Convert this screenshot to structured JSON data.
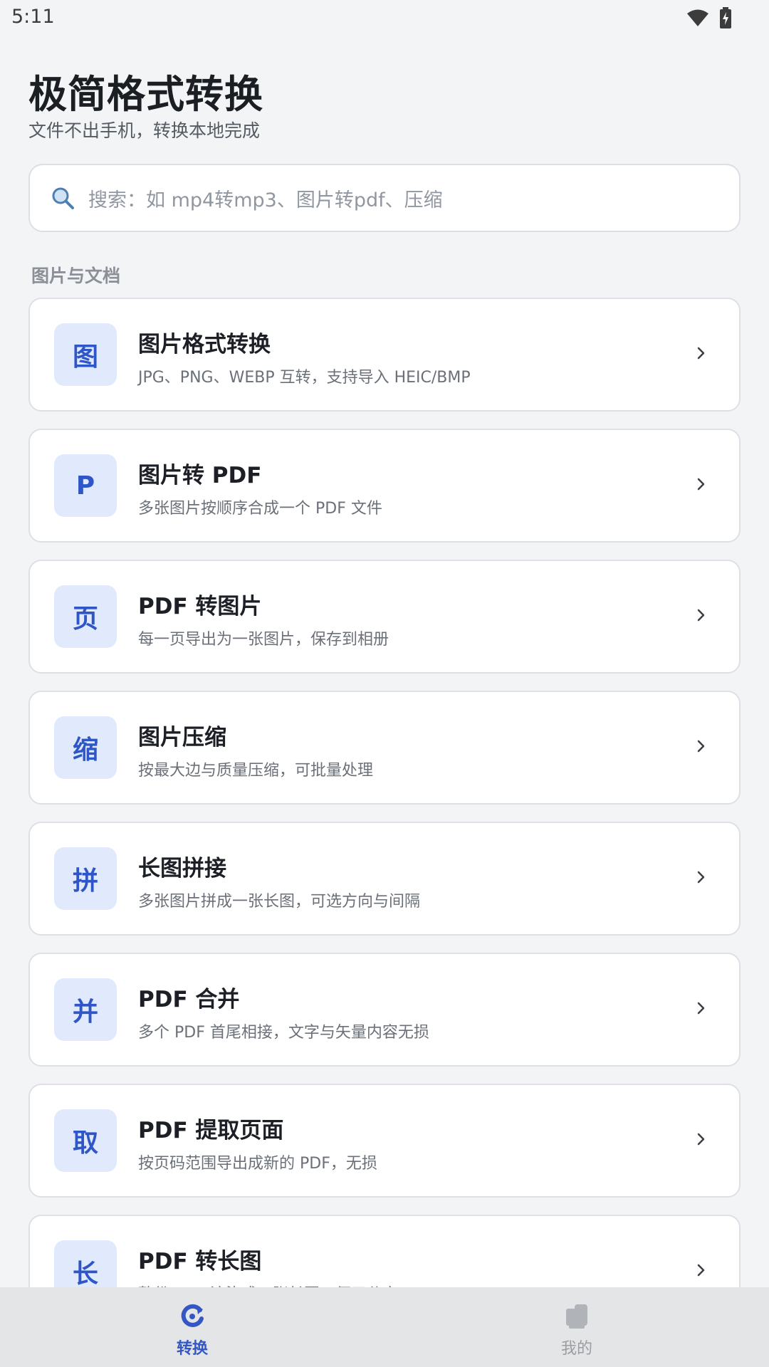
{
  "status_bar": {
    "time": "5:11"
  },
  "header": {
    "title": "极简格式转换",
    "subtitle": "文件不出手机，转换本地完成"
  },
  "search": {
    "placeholder": "搜索：如 mp4转mp3、图片转pdf、压缩"
  },
  "section": {
    "label": "图片与文档"
  },
  "tools": [
    {
      "icon_char": "图",
      "title": "图片格式转换",
      "desc": "JPG、PNG、WEBP 互转，支持导入 HEIC/BMP"
    },
    {
      "icon_char": "P",
      "title": "图片转 PDF",
      "desc": "多张图片按顺序合成一个 PDF 文件"
    },
    {
      "icon_char": "页",
      "title": "PDF 转图片",
      "desc": "每一页导出为一张图片，保存到相册"
    },
    {
      "icon_char": "缩",
      "title": "图片压缩",
      "desc": "按最大边与质量压缩，可批量处理"
    },
    {
      "icon_char": "拼",
      "title": "长图拼接",
      "desc": "多张图片拼成一张长图，可选方向与间隔"
    },
    {
      "icon_char": "并",
      "title": "PDF 合并",
      "desc": "多个 PDF 首尾相接，文字与矢量内容无损"
    },
    {
      "icon_char": "取",
      "title": "PDF 提取页面",
      "desc": "按页码范围导出成新的 PDF，无损"
    },
    {
      "icon_char": "长",
      "title": "PDF 转长图",
      "desc": "整份 PDF 渲染成一张长图，便于分享"
    }
  ],
  "bottom_nav": {
    "convert_label": "转换",
    "mine_label": "我的"
  },
  "colors": {
    "accent": "#3457c4",
    "icon_bg": "#e1e9fc",
    "page_bg": "#f3f4f6"
  }
}
